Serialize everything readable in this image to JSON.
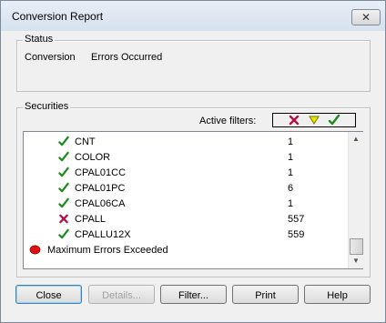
{
  "window": {
    "title": "Conversion Report",
    "close_glyph": "✕"
  },
  "status": {
    "group_label": "Status",
    "key": "Conversion",
    "value": "Errors Occurred"
  },
  "securities": {
    "group_label": "Securities",
    "active_filters_label": "Active filters:",
    "filter_icons": [
      "error-x-icon",
      "warning-triangle-icon",
      "ok-check-icon"
    ],
    "rows": [
      {
        "icon": "check-icon",
        "name": "CNT",
        "count": "1"
      },
      {
        "icon": "check-icon",
        "name": "COLOR",
        "count": "1"
      },
      {
        "icon": "check-icon",
        "name": "CPAL01CC",
        "count": "1"
      },
      {
        "icon": "check-icon",
        "name": "CPAL01PC",
        "count": "6"
      },
      {
        "icon": "check-icon",
        "name": "CPAL06CA",
        "count": "1"
      },
      {
        "icon": "error-x-icon",
        "name": "CPALL",
        "count": "557"
      },
      {
        "icon": "check-icon",
        "name": "CPALLU12X",
        "count": "559"
      },
      {
        "icon": "red-circle-icon",
        "name": "Maximum  Errors Exceeded",
        "count": ""
      }
    ],
    "scroll_up_glyph": "▲",
    "scroll_down_glyph": "▼"
  },
  "buttons": {
    "close": "Close",
    "details": "Details...",
    "filter": "Filter...",
    "print": "Print",
    "help": "Help"
  },
  "colors": {
    "check": "#1f8a1f",
    "error": "#b0104a",
    "warning": "#e8e800",
    "alert": "#e01010"
  }
}
